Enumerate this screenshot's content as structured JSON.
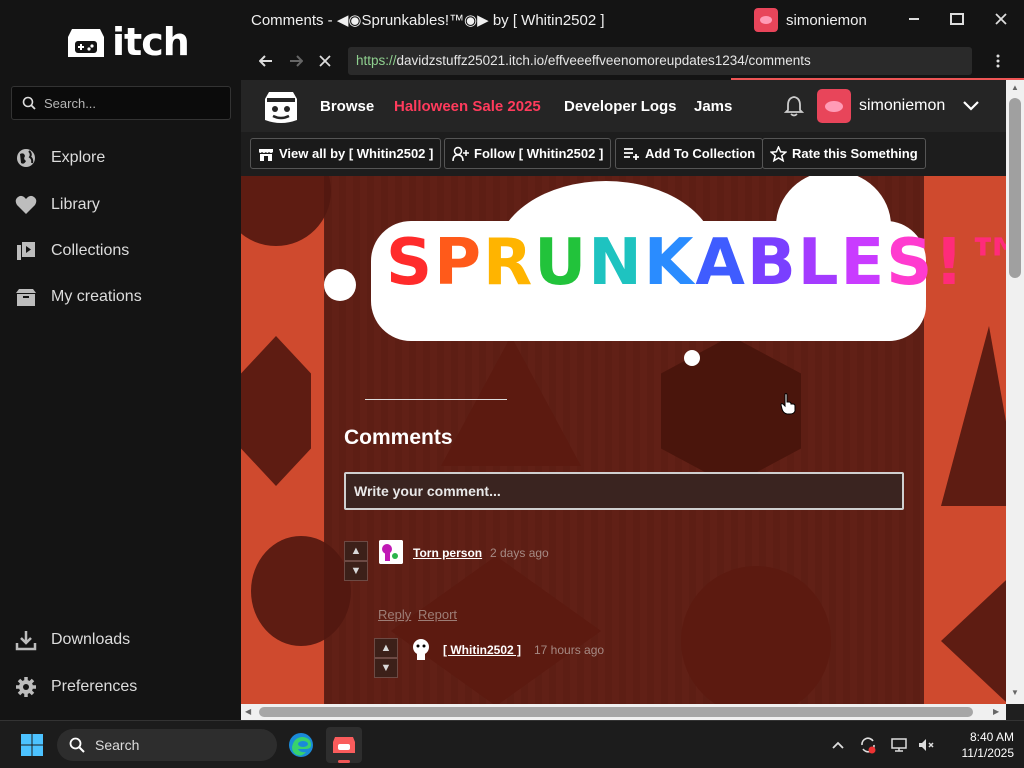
{
  "sidebar": {
    "logo_text": "itch",
    "search_placeholder": "Search...",
    "items": [
      {
        "label": "Explore",
        "icon": "globe-icon"
      },
      {
        "label": "Library",
        "icon": "heart-icon"
      },
      {
        "label": "Collections",
        "icon": "collections-icon"
      },
      {
        "label": "My creations",
        "icon": "box-icon"
      }
    ],
    "bottom_items": [
      {
        "label": "Downloads",
        "icon": "download-icon"
      },
      {
        "label": "Preferences",
        "icon": "gear-icon"
      }
    ]
  },
  "window": {
    "title": "Comments - ◀◉Sprunkables!™◉▶ by [ Whitin2502 ]",
    "username": "simoniemon"
  },
  "browser": {
    "url_proto": "https://",
    "url_rest": "davidzstuffz25021.itch.io/effveeeffveenomoreupdates1234/comments"
  },
  "site_header": {
    "nav": [
      "Browse",
      "Halloween Sale 2025",
      "Developer Logs",
      "Jams"
    ],
    "username": "simoniemon"
  },
  "toolbar": {
    "view_all": "View all by [ Whitin2502 ]",
    "follow": "Follow [ Whitin2502 ]",
    "add_collection": "Add To Collection",
    "rate": "Rate this Something"
  },
  "page": {
    "banner_text": "SPRUNKABLES!™",
    "comments_heading": "Comments",
    "comment_placeholder": "Write your comment...",
    "comments": [
      {
        "author": "Torn person",
        "time": "2 days ago",
        "reply": "Reply",
        "report": "Report"
      },
      {
        "author": "[ Whitin2502 ]",
        "time": "17 hours ago"
      }
    ]
  },
  "taskbar": {
    "search_label": "Search",
    "time": "8:40 AM",
    "date": "11/1/2025"
  },
  "colors": {
    "accent_sale": "#ff3b5c",
    "page_bg": "#7a2a1c",
    "side_orange": "#cf4a2e"
  }
}
